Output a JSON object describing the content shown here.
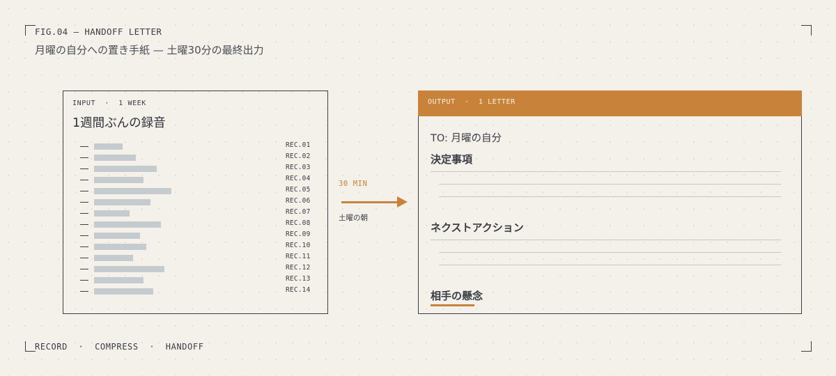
{
  "figure": {
    "label": "FIG.04 — HANDOFF LETTER",
    "title": "月曜の自分への置き手紙 — 土曜30分の最終出力"
  },
  "input_panel": {
    "tag": "INPUT  ·  1 WEEK",
    "heading": "1週間ぶんの録音",
    "records": [
      {
        "label": "REC.01",
        "length": 0.27
      },
      {
        "label": "REC.02",
        "length": 0.4
      },
      {
        "label": "REC.03",
        "length": 0.6
      },
      {
        "label": "REC.04",
        "length": 0.47
      },
      {
        "label": "REC.05",
        "length": 0.74
      },
      {
        "label": "REC.06",
        "length": 0.54
      },
      {
        "label": "REC.07",
        "length": 0.34
      },
      {
        "label": "REC.08",
        "length": 0.64
      },
      {
        "label": "REC.09",
        "length": 0.44
      },
      {
        "label": "REC.10",
        "length": 0.5
      },
      {
        "label": "REC.11",
        "length": 0.37
      },
      {
        "label": "REC.12",
        "length": 0.67
      },
      {
        "label": "REC.13",
        "length": 0.47
      },
      {
        "label": "REC.14",
        "length": 0.57
      }
    ]
  },
  "arrow": {
    "time_label": "30 MIN",
    "caption": "土曜の朝"
  },
  "output_panel": {
    "tag": "OUTPUT  ·  1 LETTER",
    "to_line": "TO: 月曜の自分",
    "sections": {
      "decisions": "決定事項",
      "next_actions": "ネクストアクション",
      "concerns": "相手の懸念"
    }
  },
  "footer": "RECORD  ·  COMPRESS  ·  HANDOFF",
  "colors": {
    "accent": "#c8823a",
    "background": "#f4f1ea",
    "ink": "#3a3d44",
    "bar": "#c6cbd0"
  }
}
